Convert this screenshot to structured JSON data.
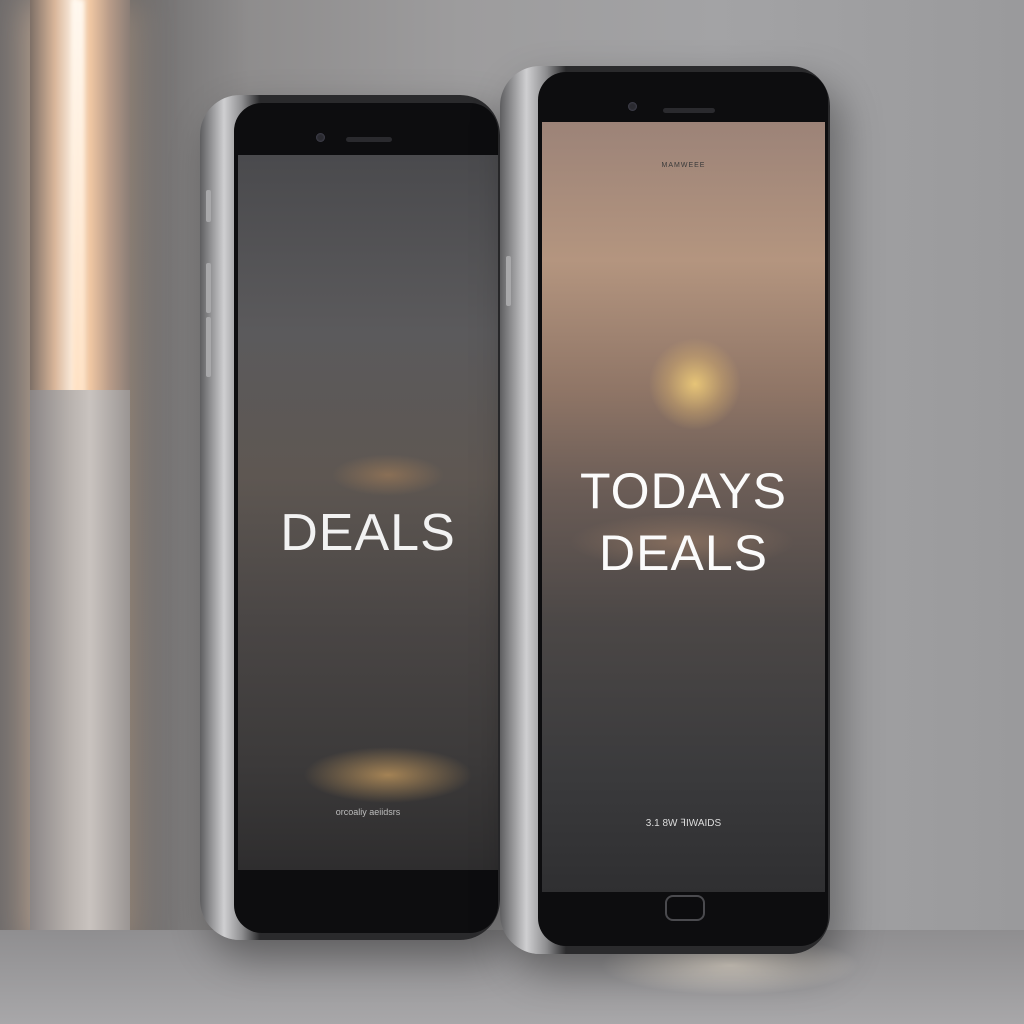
{
  "scene": {
    "description_colors": {
      "wall": "#9d9c9d",
      "light_strip": "#fff3e6",
      "phone_frame": "#cfcfd1",
      "bezel": "#0d0d0f"
    }
  },
  "phone_left": {
    "screen_text": "DEALS",
    "footer_text": "orcoaliy aeiidsrs"
  },
  "phone_right": {
    "top_label": "MAMWEEE",
    "title_line_1": "TODAYS",
    "title_line_2": "DEALS",
    "footer_text": "3.1 8W ꟻIWAIDS"
  }
}
